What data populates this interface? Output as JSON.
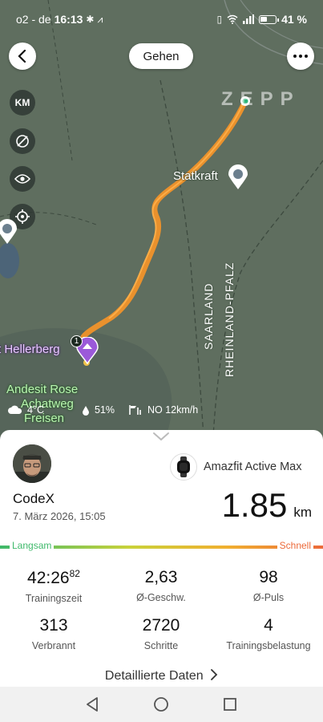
{
  "status_bar": {
    "carrier": "o2 - de",
    "time": "16:13",
    "battery": "41 %"
  },
  "header": {
    "activity_type": "Gehen",
    "brand_watermark": "ZEPP"
  },
  "map_controls": {
    "unit_button": "KM"
  },
  "map_labels": {
    "statkraft": "Statkraft",
    "hellerberg": "t Hellerberg",
    "andesit_line1": "Andesit Rose",
    "andesit_line2": "Achatweg",
    "andesit_line3": "Freisen",
    "region_saarland": "SAARLAND",
    "region_rlp": "RHEINLAND-PFALZ",
    "start_marker_number": "1"
  },
  "weather": {
    "temperature": "4°C",
    "humidity": "51%",
    "wind": "NO 12km/h"
  },
  "summary": {
    "user_name": "CodeX",
    "date": "7. März 2026, 15:05",
    "device_name": "Amazfit Active Max",
    "distance_value": "1.85",
    "distance_unit": "km",
    "speed_slow_label": "Langsam",
    "speed_fast_label": "Schnell"
  },
  "stats": [
    {
      "value": "42:26",
      "value_sup": "82",
      "label": "Trainingszeit"
    },
    {
      "value": "2,63",
      "value_sup": "",
      "label": "Ø-Geschw."
    },
    {
      "value": "98",
      "value_sup": "",
      "label": "Ø-Puls"
    },
    {
      "value": "313",
      "value_sup": "",
      "label": "Verbrannt"
    },
    {
      "value": "2720",
      "value_sup": "",
      "label": "Schritte"
    },
    {
      "value": "4",
      "value_sup": "",
      "label": "Trainingsbelastung"
    }
  ],
  "detail_link": "Detaillierte Daten",
  "colors": {
    "map_bg": "#5f6e5f",
    "route": "#f0922a",
    "speed_slow": "#3fb96b",
    "speed_fast": "#ec6a3a",
    "poi_marker": "#9b59d9"
  },
  "icons": {
    "back": "chevron-left-icon",
    "more": "more-horizontal-icon",
    "map_layer": "layer-off-icon",
    "view": "eye-icon",
    "locate": "locate-icon",
    "nav_back": "triangle-back-icon",
    "nav_home": "circle-home-icon",
    "nav_recent": "square-recent-icon"
  }
}
